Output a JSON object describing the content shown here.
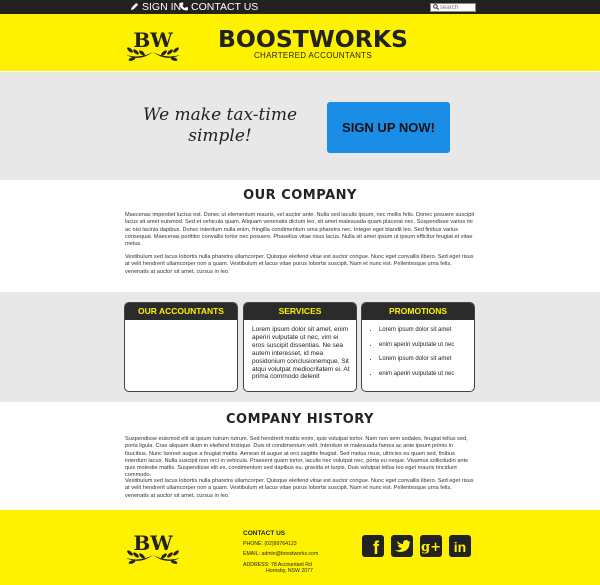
{
  "topnav": {
    "signin_label": "SIGN IN",
    "contact_label": "CONTACT US",
    "search_placeholder": "search"
  },
  "header": {
    "brand": "BOOSTWORKS",
    "tagline": "CHARTERED ACCOUNTANTS",
    "logo_text": "BW"
  },
  "hero": {
    "headline": "We make tax-time simple!",
    "cta_label": "SIGN UP NOW!"
  },
  "company": {
    "title": "OUR COMPANY",
    "para1": "Maecenas imperdiet luctus est. Donec ut elementum mauris, vel auctor ante. Nulla sed iaculis ipsum, nec mollis felis. Donec posuere suscipit lacus sit amet euismod. Sed et vehicula quam. Aliquam venenatis dictum leo, sit amet malesuada quam placerat nec. Suspendisse varius mi ac nisi lacinia dapibus. Donec interdum nulla enim, fringilla condimentum urna pharetra nec. Integer eget blandit leo. Sed finibus varius consequat. Maecenas porttitor convallis tortor nec posuere. Phasellus vitae risus lacus. Nulla sit amet ipsum ut ipsum efficitur feugiat et vitae metus.",
    "para2": "Vestibulum sed lacus lobortis nulla pharetra ullamcorper. Quisque eleifend vitae est auctor congue. Nunc eget convallis libero. Sed eget risus at velit hendrerit ullamcorper non a quam. Vestibulum et lacus vitae purus lobortis suscipit. Nam et nunc est. Pellentesque urna felis, venenatis at auctor sit amet, cursus in leo."
  },
  "cards": {
    "accountants": {
      "title": "OUR ACCOUNTANTS"
    },
    "services": {
      "title": "SERVICES",
      "text": "Lorem ipsum dolor sit amet, enim aperiri vulputate ut nec, vim ei eros suscipit dissentias. Ne sea autem interesset, id mea posidonium conclusionemque. Sit atqui volutpat mediocritatem ei. At prima commodo delenit"
    },
    "promotions": {
      "title": "PROMOTIONS",
      "items": [
        "Lorem ipsum dolor sit amet",
        "enim aperiri vulputate ut nec",
        "Lorem ipsum dolor sit amet",
        "enim aperiri vulputate ut nec"
      ]
    }
  },
  "history": {
    "title": "COMPANY HISTORY",
    "para1": "Suspendisse euismod elit at ipsum rutrum rutrum. Sed hendrerit mattis enim, quis volutpat tortor. Nam non sem sodales, feugiat tellus sed, porta ligula. Cras aliquam diam in eleifend tristique. Duis id condimentum velit. Interdum et malesuada fames ac ante ipsum primis in faucibus. Nunc laoreet augue a feugiat mattis. Aenean id augue at orci sagittis feugiat. Sed metus risus, ultricies eu quam sed, finibus interdum lacus. Nulla suscipit non orci in vehicula. Praesent quam tortor, iaculis nec volutpat nec, porta eu neque. Vivamus sollicitudin ante quis molestie mattis. Suspendisse elit ex, condimentum sed dapibus eu, gravida et turpis. Duis volutpat tellus leo eget mauris tincidunt commodo.",
    "para2": "Vestibulum sed lacus lobortis nulla pharetra ullamcorper. Quisque eleifend vitae est auctor congue. Nunc eget convallis libero. Sed eget risus at velit hendrerit ullamcorper non a quam. Vestibulum et lacus vitae purus lobortis suscipit. Nam et nunc est. Pellentesque urna felis, venenatis at auctor sit amet, cursus in leo."
  },
  "footer": {
    "contact_title": "CONTACT US",
    "phone": "PHONE: (02)99764123",
    "email": "EMAIL: admin@boostworks.com",
    "address_line1": "ADDRESS: 78 Accountant Rd",
    "address_line2": "Hornsby, NSW 2077",
    "social_icons": [
      "facebook-icon",
      "twitter-icon",
      "google-plus-icon",
      "linkedin-icon"
    ],
    "google_plus_text": "g+",
    "linkedin_text": "in",
    "facebook_text": "f"
  },
  "colors": {
    "yellow": "#fff200",
    "dark": "#222222",
    "band": "#e8e8e8",
    "cta": "#1a8ee6"
  }
}
